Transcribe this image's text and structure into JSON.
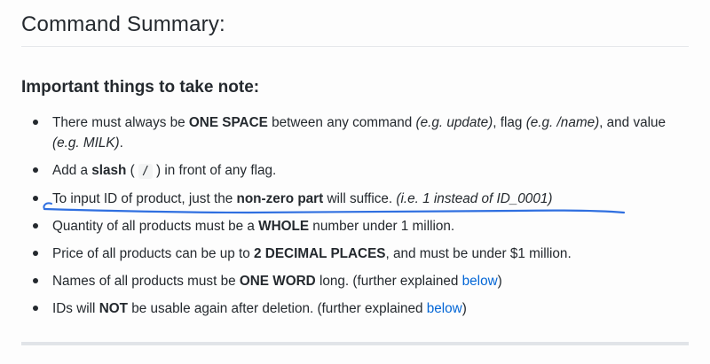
{
  "section": {
    "title": "Command Summary:"
  },
  "subsection": {
    "title": "Important things to take note:"
  },
  "notes": [
    {
      "a": "There must always be ",
      "b": "ONE SPACE",
      "c": " between any command ",
      "d": "(e.g. update)",
      "e": ", flag ",
      "f": "(e.g. /name)",
      "g": ", and value ",
      "h": "(e.g. MILK)",
      "i": "."
    },
    {
      "a": "Add a ",
      "b": "slash",
      "c": " ( ",
      "code": "/",
      "d": " ) in front of any flag."
    },
    {
      "a": "To input ID of product, just the ",
      "b": "non-zero part",
      "c": " will suffice. ",
      "d": "(i.e. 1 instead of ID_0001)"
    },
    {
      "a": "Quantity of all products must be a ",
      "b": "WHOLE",
      "c": " number under 1 million."
    },
    {
      "a": "Price of all products can be up to ",
      "b": "2 DECIMAL PLACES",
      "c": ", and must be under $1 million."
    },
    {
      "a": "Names of all products must be ",
      "b": "ONE WORD",
      "c": " long. (further explained ",
      "link": "below",
      "d": ")"
    },
    {
      "a": "IDs will ",
      "b": "NOT",
      "c": " be usable again after deletion. (further explained ",
      "link": "below",
      "d": ")"
    }
  ],
  "colors": {
    "text": "#24292e",
    "link": "#0366d6",
    "annotation_ink": "#2f6fe0",
    "rule": "#e1e4e8"
  }
}
